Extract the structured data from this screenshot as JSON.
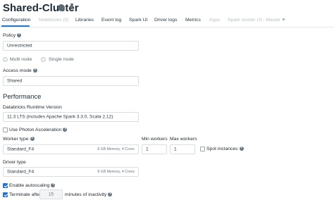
{
  "header": {
    "title": "Shared-Cluster"
  },
  "tabs": [
    {
      "label": "Configuration"
    },
    {
      "label": "Notebooks (0)"
    },
    {
      "label": "Libraries"
    },
    {
      "label": "Event log"
    },
    {
      "label": "Spark UI"
    },
    {
      "label": "Driver logs"
    },
    {
      "label": "Metrics"
    },
    {
      "label": "Apps"
    },
    {
      "label": "Spark cluster UI - Master"
    }
  ],
  "policy": {
    "label": "Policy",
    "value": "Unrestricted"
  },
  "node_mode": {
    "multi": "Multi node",
    "single": "Single node"
  },
  "access_mode": {
    "label": "Access mode",
    "value": "Shared"
  },
  "performance": {
    "heading": "Performance",
    "runtime_label": "Databricks Runtime Version",
    "runtime_value": "11.3 LTS (includes Apache Spark 3.3.0, Scala 2.12)",
    "photon_label": "Use Photon Acceleration",
    "worker_type_label": "Worker type",
    "worker_type_value": "Standard_F4",
    "worker_type_spec": "8 GB Memory, 4 Cores",
    "min_workers_label": "Min workers",
    "min_workers_value": "1",
    "max_workers_label": "Max workers",
    "max_workers_value": "1",
    "spot_label": "Spot instances",
    "driver_type_label": "Driver type",
    "driver_type_value": "Standard_F4",
    "driver_type_spec": "8 GB Memory, 4 Cores",
    "autoscaling_label": "Enable autoscaling",
    "terminate_prefix": "Terminate after",
    "terminate_value": "15",
    "terminate_suffix": "minutes of inactivity"
  }
}
